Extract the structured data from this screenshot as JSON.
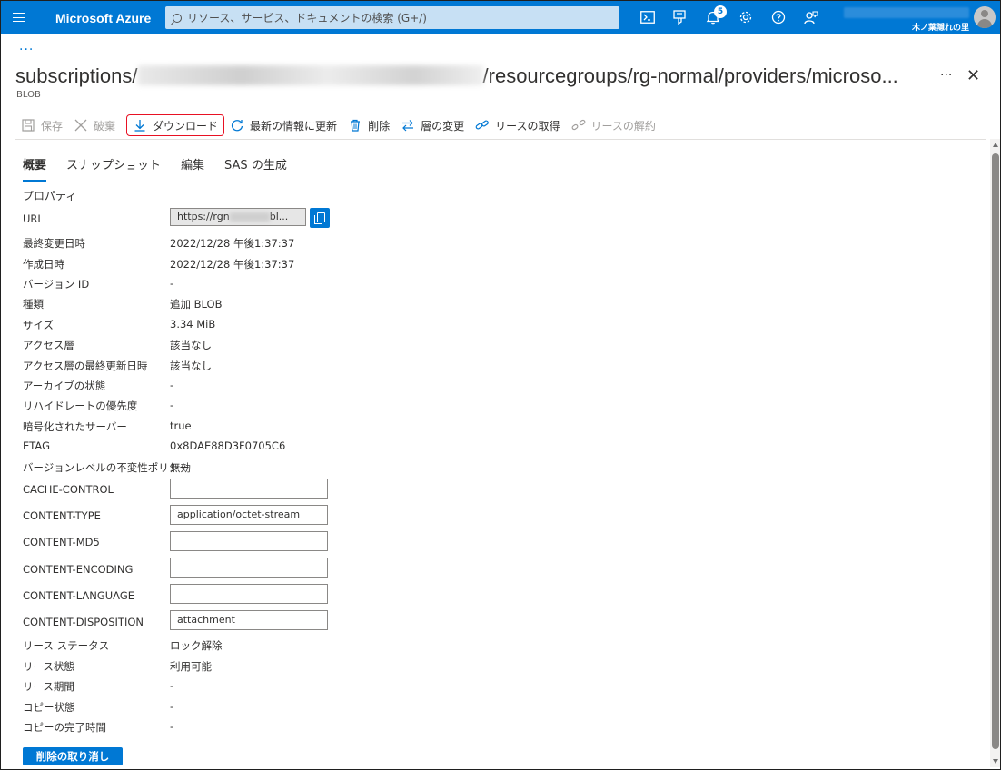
{
  "topbar": {
    "brand": "Microsoft Azure",
    "search_placeholder": "リソース、サービス、ドキュメントの検索 (G+/)",
    "notification_count": "5",
    "directory": "木ノ葉隠れの里"
  },
  "breadcrumb": {
    "more": "..."
  },
  "header": {
    "title_prefix": "subscriptions/",
    "title_suffix": "/resourcegroups/rg-normal/providers/microso...",
    "subtitle": "BLOB",
    "more": "···",
    "close": "✕"
  },
  "toolbar": {
    "save": "保存",
    "discard": "破棄",
    "download": "ダウンロード",
    "refresh": "最新の情報に更新",
    "delete": "削除",
    "change_tier": "層の変更",
    "acquire_lease": "リースの取得",
    "break_lease": "リースの解約"
  },
  "tabs": [
    "概要",
    "スナップショット",
    "編集",
    "SAS の生成"
  ],
  "properties": {
    "section_label": "プロパティ",
    "url_label": "URL",
    "url_value_start": "https://rgn",
    "url_value_end": "bl...",
    "rows": [
      {
        "k": "最終変更日時",
        "v": "2022/12/28 午後1:37:37"
      },
      {
        "k": "作成日時",
        "v": "2022/12/28 午後1:37:37"
      },
      {
        "k": "バージョン ID",
        "v": "-"
      },
      {
        "k": "種類",
        "v": "追加 BLOB"
      },
      {
        "k": "サイズ",
        "v": "3.34 MiB"
      },
      {
        "k": "アクセス層",
        "v": "該当なし"
      },
      {
        "k": "アクセス層の最終更新日時",
        "v": "該当なし"
      },
      {
        "k": "アーカイブの状態",
        "v": "-"
      },
      {
        "k": "リハイドレートの優先度",
        "v": "-"
      },
      {
        "k": "暗号化されたサーバー",
        "v": "true"
      },
      {
        "k": "ETAG",
        "v": "0x8DAE88D3F0705C6"
      },
      {
        "k": "バージョンレベルの不変性ポリシー",
        "v": "無効"
      }
    ],
    "fields": [
      {
        "k": "CACHE-CONTROL",
        "v": ""
      },
      {
        "k": "CONTENT-TYPE",
        "v": "application/octet-stream"
      },
      {
        "k": "CONTENT-MD5",
        "v": ""
      },
      {
        "k": "CONTENT-ENCODING",
        "v": ""
      },
      {
        "k": "CONTENT-LANGUAGE",
        "v": ""
      },
      {
        "k": "CONTENT-DISPOSITION",
        "v": "attachment"
      }
    ],
    "rows2": [
      {
        "k": "リース ステータス",
        "v": "ロック解除"
      },
      {
        "k": "リース状態",
        "v": "利用可能"
      },
      {
        "k": "リース期間",
        "v": "-"
      },
      {
        "k": "コピー状態",
        "v": "-"
      },
      {
        "k": "コピーの完了時間",
        "v": "-"
      }
    ]
  },
  "undelete_button": "削除の取り消し"
}
